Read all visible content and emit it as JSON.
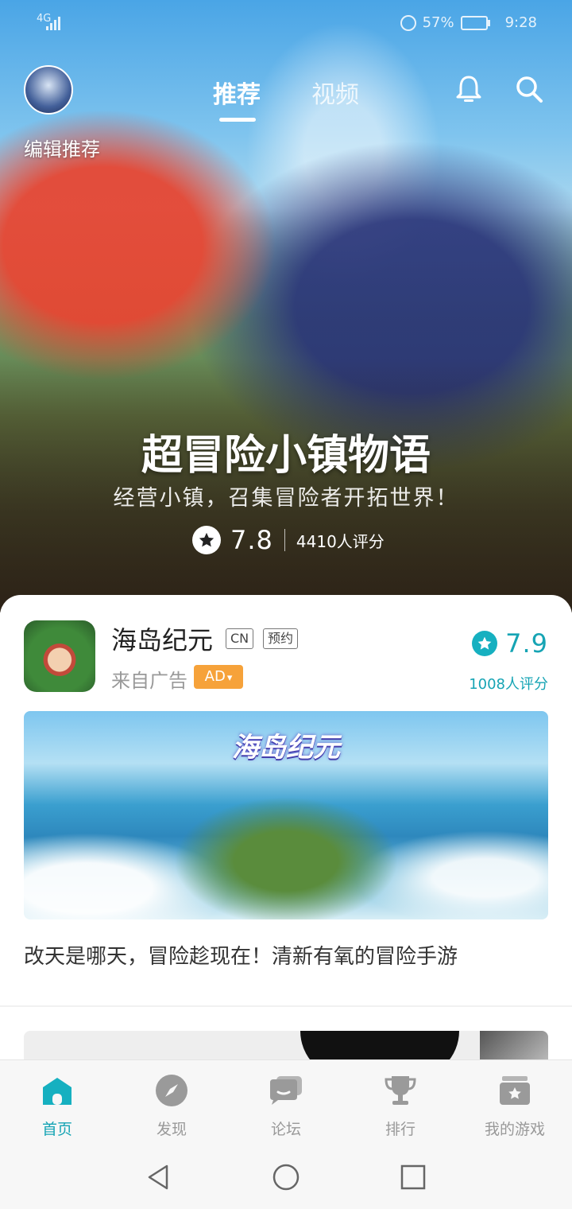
{
  "status_bar": {
    "network": "4G",
    "battery": "57%",
    "time": "9:28"
  },
  "header": {
    "edit_label": "编辑推荐",
    "tabs": [
      {
        "label": "推荐",
        "active": true
      },
      {
        "label": "视频",
        "active": false
      }
    ],
    "icons": [
      "bell-icon",
      "search-icon"
    ]
  },
  "featured": {
    "title": "超冒险小镇物语",
    "subtitle": "经营小镇，召集冒险者开拓世界！",
    "score": "7.8",
    "rating_count": "4410人评分"
  },
  "ad_card": {
    "app_name": "海岛纪元",
    "tags": [
      "CN",
      "预约"
    ],
    "source": "来自广告",
    "ad_badge": "AD",
    "score": "7.9",
    "rating_count": "1008人评分",
    "banner_logo": "海岛纪元",
    "description": "改天是哪天，冒险趁现在！清新有氧的冒险手游"
  },
  "tab_bar": [
    {
      "label": "首页",
      "icon": "home-icon",
      "active": true
    },
    {
      "label": "发现",
      "icon": "compass-icon",
      "active": false
    },
    {
      "label": "论坛",
      "icon": "chat-icon",
      "active": false
    },
    {
      "label": "排行",
      "icon": "trophy-icon",
      "active": false
    },
    {
      "label": "我的游戏",
      "icon": "game-box-icon",
      "active": false
    }
  ],
  "colors": {
    "accent": "#16a4b4",
    "ad_orange": "#f6a23a"
  }
}
